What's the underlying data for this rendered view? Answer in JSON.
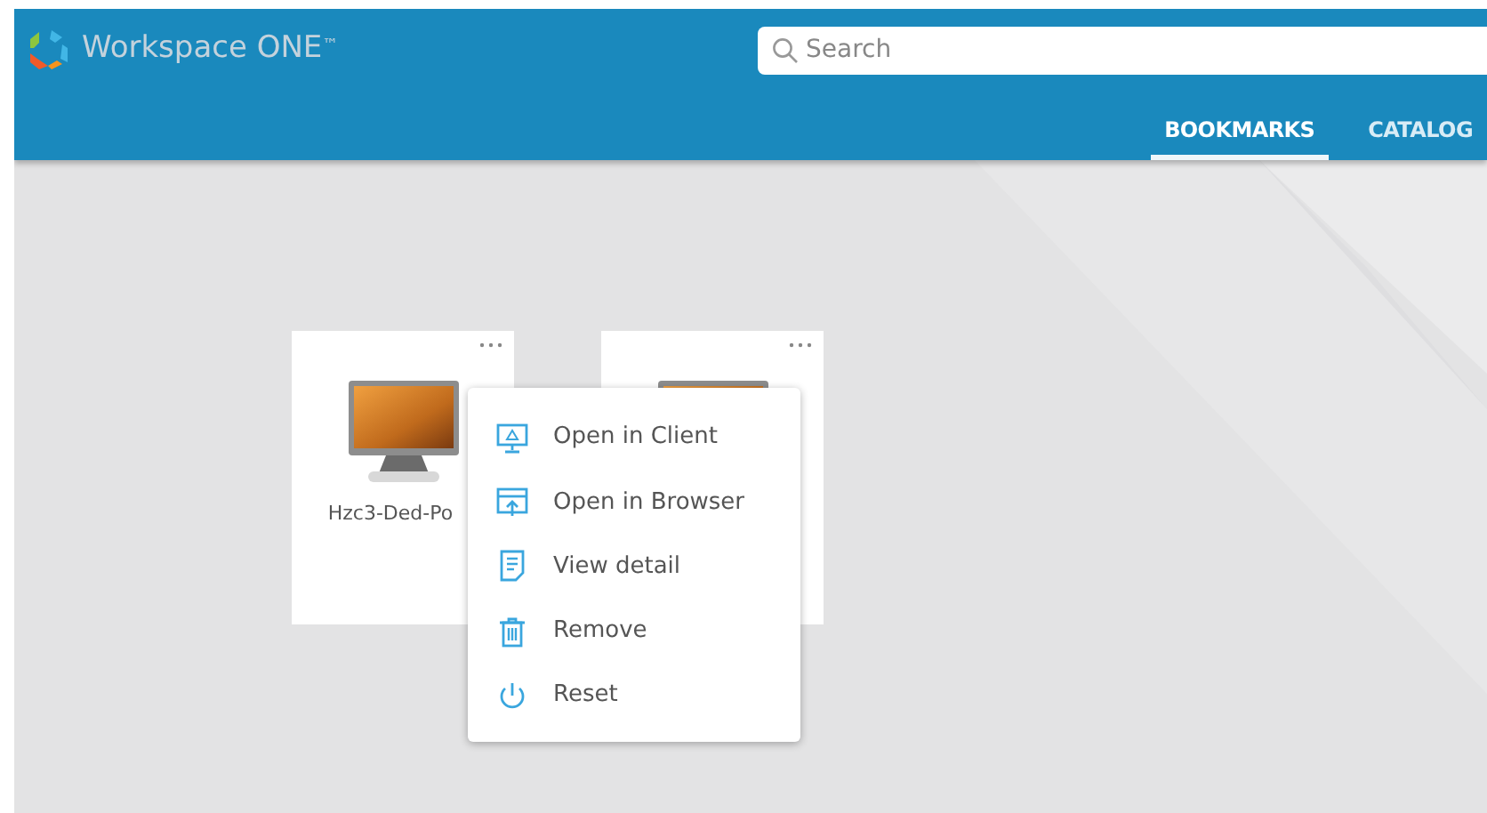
{
  "header": {
    "logo_text": "Workspace ONE",
    "trademark": "™",
    "search": {
      "placeholder": "Search"
    }
  },
  "tabs": [
    {
      "label": "BOOKMARKS",
      "selected": true
    },
    {
      "label": "CATALOG",
      "selected": false
    }
  ],
  "cards": [
    {
      "kind": "desktop",
      "name": "Hzc3-Ded-Po"
    },
    {
      "kind": "desktop"
    }
  ],
  "context_menu": {
    "items": [
      {
        "kind": "client",
        "label": "Open in Client"
      },
      {
        "kind": "browser",
        "label": "Open in Browser"
      },
      {
        "kind": "detail",
        "label": "View detail"
      },
      {
        "kind": "remove",
        "label": "Remove"
      },
      {
        "kind": "reset",
        "label": "Reset"
      }
    ]
  }
}
